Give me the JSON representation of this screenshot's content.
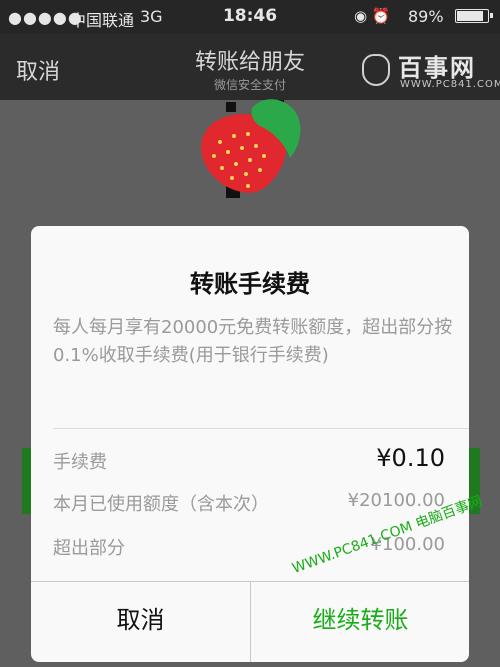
{
  "status_bar": {
    "signal": "●●●●●",
    "carrier": "中国联通",
    "network": "3G",
    "time": "18:46",
    "status_icons": "◉ ⏰",
    "battery": "89%",
    "battery_level": 0.89
  },
  "nav": {
    "cancel": "取消",
    "title": "转账给朋友",
    "subtitle": "微信安全支付"
  },
  "watermark": {
    "brand": "百事网",
    "url": "WWW.PC841.COM",
    "bottom_text": "WWW.PC841.COM 电脑百事网"
  },
  "dialog": {
    "title": "转账手续费",
    "description": "每人每月享有20000元免费转账额度，超出部分按0.1%收取手续费(用于银行手续费)",
    "rows": [
      {
        "label": "手续费",
        "value": "¥0.10"
      },
      {
        "label": "本月已使用额度（含本次）",
        "value": "¥20100.00"
      },
      {
        "label": "超出部分",
        "value": "¥100.00"
      }
    ],
    "cancel_button": "取消",
    "confirm_button": "继续转账"
  },
  "colors": {
    "accent_green": "#1aac19",
    "avatar_red": "#e0282e",
    "avatar_leaf": "#2aa84a"
  },
  "icons": {
    "avatar": "strawberry-icon",
    "logo": "mouse-icon"
  }
}
